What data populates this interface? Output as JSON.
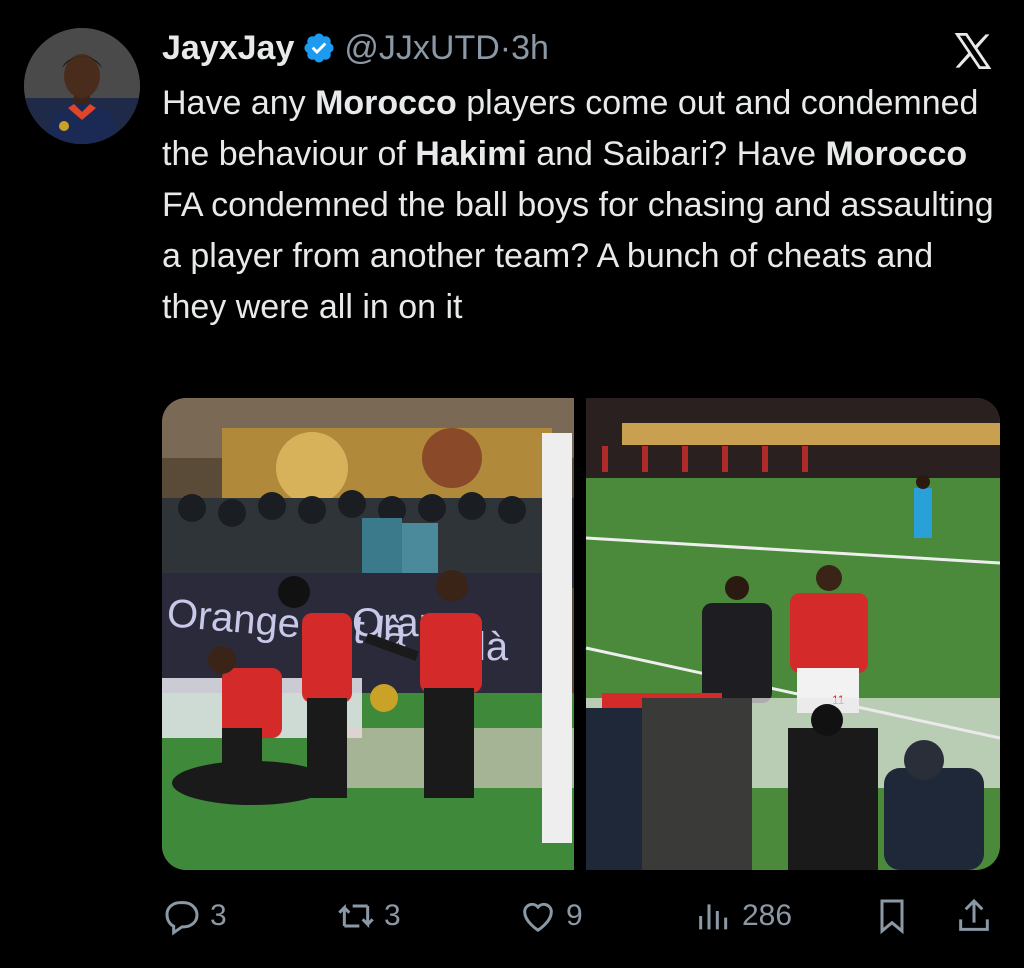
{
  "tweet": {
    "display_name": "JayxJay",
    "handle": "@JJxUTD",
    "separator": "·",
    "time": "3h",
    "text_segments": [
      {
        "t": "Have any ",
        "b": false
      },
      {
        "t": "Morocco",
        "b": true
      },
      {
        "t": " players come out and condemned the behaviour of ",
        "b": false
      },
      {
        "t": "Hakimi",
        "b": true
      },
      {
        "t": " and Saibari? Have ",
        "b": false
      },
      {
        "t": "Morocco",
        "b": true
      },
      {
        "t": " FA condemned the ball boys for chasing and assaulting a player from another team? A bunch of cheats and they were all in on it",
        "b": false
      }
    ],
    "banner_left": "Orange est là",
    "banner_left_2": "Oran",
    "banner_left_3": "là",
    "jersey_number": "11"
  },
  "actions": {
    "replies": "3",
    "retweets": "3",
    "likes": "9",
    "views": "286"
  },
  "colors": {
    "background": "#000000",
    "text": "#e7e9ea",
    "muted": "#8b98a5",
    "verified": "#1d9bf0"
  },
  "icons": [
    "x-logo-icon",
    "verified-badge-icon",
    "reply-icon",
    "retweet-icon",
    "like-icon",
    "views-icon",
    "bookmark-icon",
    "share-icon"
  ]
}
